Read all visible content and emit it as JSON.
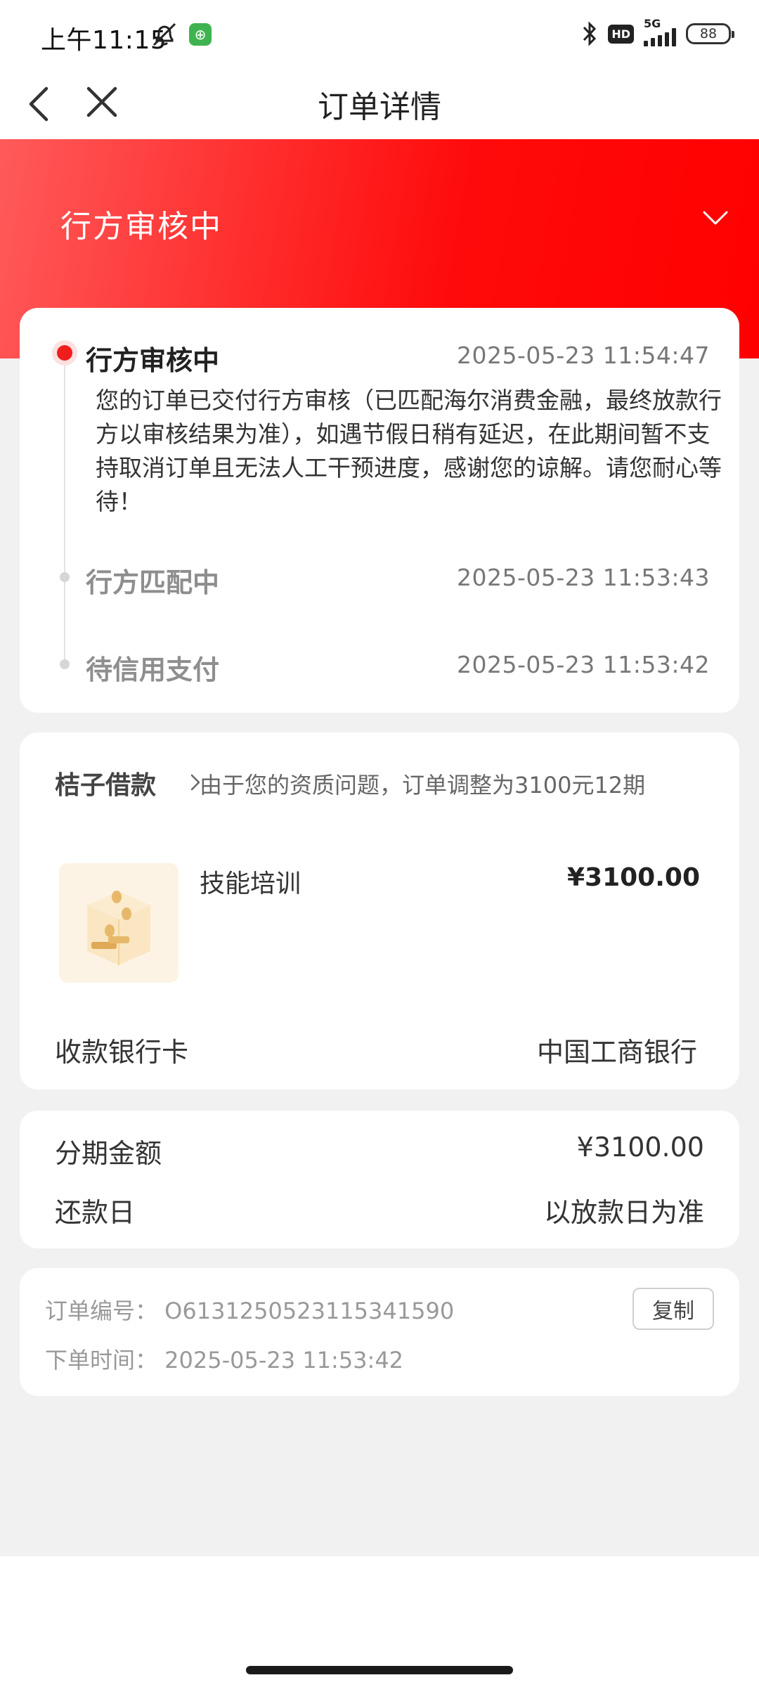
{
  "status_bar": {
    "time": "上午11:15",
    "network": "5G",
    "hd": "HD",
    "battery": "88"
  },
  "nav": {
    "title": "订单详情"
  },
  "banner": {
    "title": "行方审核中"
  },
  "timeline": {
    "steps": [
      {
        "title": "行方审核中",
        "time": "2025-05-23 11:54:47",
        "desc": "您的订单已交付行方审核（已匹配海尔消费金融，最终放款行方以审核结果为准），如遇节假日稍有延迟，在此期间暂不支持取消订单且无法人工干预进度，感谢您的谅解。请您耐心等待！"
      },
      {
        "title": "行方匹配中",
        "time": "2025-05-23 11:53:43"
      },
      {
        "title": "待信用支付",
        "time": "2025-05-23 11:53:42"
      }
    ]
  },
  "loan": {
    "brand": "桔子借款",
    "note": "由于您的资质问题，订单调整为3100元12期",
    "product_name": "技能培训",
    "product_price": "¥3100.00",
    "bank_label": "收款银行卡",
    "bank_value": "中国工商银行"
  },
  "installment": {
    "amount_label": "分期金额",
    "amount_value": "¥3100.00",
    "repay_label": "还款日",
    "repay_value": "以放款日为准"
  },
  "order": {
    "number_line": "订单编号：  O6131250523115341590",
    "time_line": "下单时间：  2025-05-23 11:53:42",
    "copy_label": "复制"
  },
  "colors": {
    "brand_red": "#ff1a1a",
    "active_dot": "#f01d1d",
    "bg": "#f1f1f1"
  }
}
